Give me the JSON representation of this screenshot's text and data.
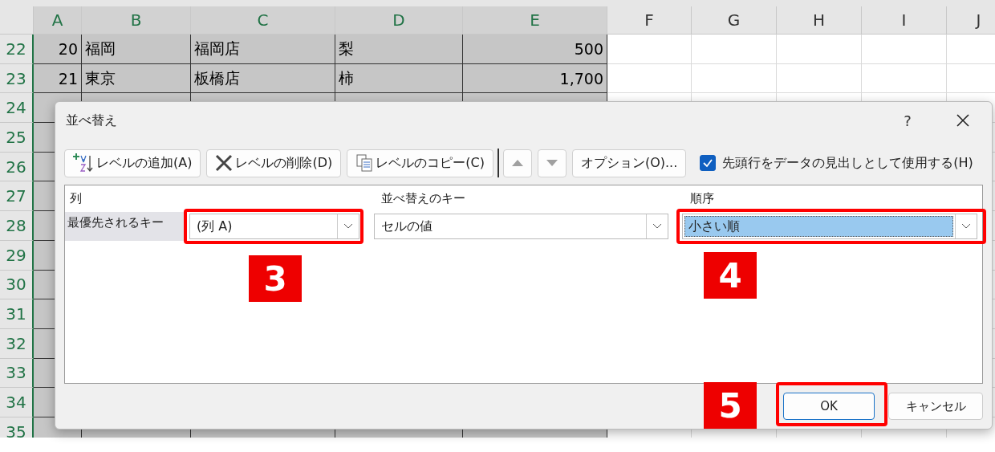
{
  "sheet": {
    "columns": [
      {
        "label": "A",
        "selected": true
      },
      {
        "label": "B",
        "selected": true
      },
      {
        "label": "C",
        "selected": true
      },
      {
        "label": "D",
        "selected": true
      },
      {
        "label": "E",
        "selected": true
      },
      {
        "label": "F",
        "selected": false
      },
      {
        "label": "G",
        "selected": false
      },
      {
        "label": "H",
        "selected": false
      },
      {
        "label": "I",
        "selected": false
      },
      {
        "label": "J",
        "selected": false
      }
    ],
    "rows": [
      {
        "number": "22",
        "selected": true,
        "cells": [
          "20",
          "福岡",
          "福岡店",
          "梨",
          "500"
        ]
      },
      {
        "number": "23",
        "selected": true,
        "cells": [
          "21",
          "東京",
          "板橋店",
          "柿",
          "1,700"
        ]
      },
      {
        "number": "24",
        "selected": true
      },
      {
        "number": "25",
        "selected": true
      },
      {
        "number": "26",
        "selected": true
      },
      {
        "number": "27",
        "selected": true
      },
      {
        "number": "28",
        "selected": true
      },
      {
        "number": "29",
        "selected": true
      },
      {
        "number": "30",
        "selected": true
      },
      {
        "number": "31",
        "selected": true
      },
      {
        "number": "32",
        "selected": true
      },
      {
        "number": "33",
        "selected": true
      },
      {
        "number": "34",
        "selected": true
      },
      {
        "number": "35",
        "selected": true
      }
    ]
  },
  "dialog": {
    "title": "並べ替え",
    "help": "?",
    "toolbar": [
      {
        "kind": "add",
        "label": "レベルの追加(A)",
        "disabled": false
      },
      {
        "kind": "delete",
        "label": "レベルの削除(D)",
        "disabled": false
      },
      {
        "kind": "copy",
        "label": "レベルのコピー(C)",
        "disabled": false
      },
      {
        "kind": "up",
        "disabled": true
      },
      {
        "kind": "down",
        "disabled": true
      },
      {
        "kind": "text",
        "label": "オプション(O)...",
        "disabled": false
      }
    ],
    "header_checkbox": {
      "label": "先頭行をデータの見出しとして使用する(H)",
      "checked": true
    },
    "columns": [
      "列",
      "並べ替えのキー",
      "順序"
    ],
    "levels": [
      {
        "label": "最優先されるキー",
        "column": "(列 A)",
        "key": "セルの値",
        "order": "小さい順",
        "order_selected": true
      }
    ],
    "buttons": [
      {
        "label": "OK",
        "default": true
      },
      {
        "label": "キャンセル",
        "default": false
      }
    ]
  },
  "annotations": [
    {
      "number": "3"
    },
    {
      "number": "4"
    },
    {
      "number": "5"
    }
  ]
}
